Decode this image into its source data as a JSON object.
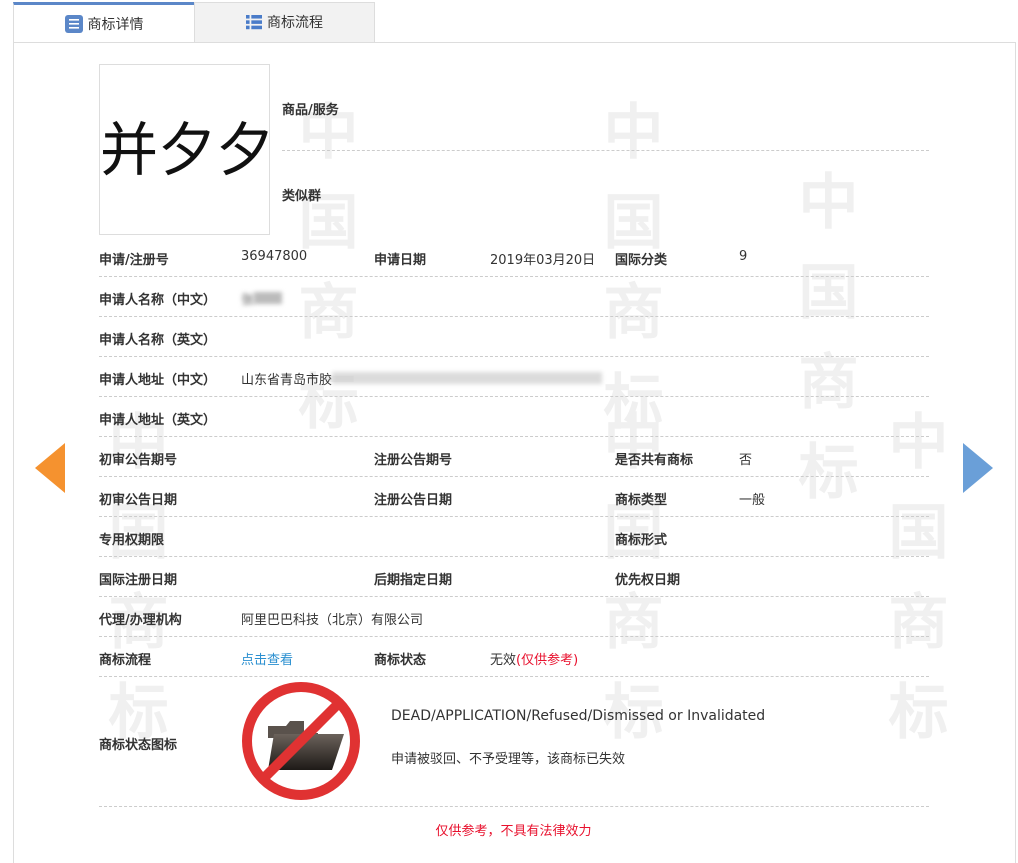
{
  "tabs": [
    {
      "label": "商标详情",
      "icon": "document-list-icon",
      "active": true
    },
    {
      "label": "商标流程",
      "icon": "grid-list-icon",
      "active": false
    }
  ],
  "logo_text": "并夕夕",
  "goods_label": "商品/服务",
  "similar_group_label": "类似群",
  "fields": {
    "reg_no": {
      "label": "申请/注册号",
      "value": "36947800"
    },
    "app_date": {
      "label": "申请日期",
      "value": "2019年03月20日"
    },
    "intl_class": {
      "label": "国际分类",
      "value": "9"
    },
    "applicant_cn": {
      "label": "申请人名称（中文）",
      "value": "张"
    },
    "applicant_en": {
      "label": "申请人名称（英文）",
      "value": ""
    },
    "address_cn": {
      "label": "申请人地址（中文）",
      "value": "山东省青岛市胶"
    },
    "address_en": {
      "label": "申请人地址（英文）",
      "value": ""
    },
    "prelim_issue": {
      "label": "初审公告期号",
      "value": ""
    },
    "reg_issue": {
      "label": "注册公告期号",
      "value": ""
    },
    "shared": {
      "label": "是否共有商标",
      "value": "否"
    },
    "prelim_date": {
      "label": "初审公告日期",
      "value": ""
    },
    "reg_date": {
      "label": "注册公告日期",
      "value": ""
    },
    "tm_type": {
      "label": "商标类型",
      "value": "一般"
    },
    "exclusive_term": {
      "label": "专用权期限",
      "value": ""
    },
    "tm_form": {
      "label": "商标形式",
      "value": ""
    },
    "intl_reg_date": {
      "label": "国际注册日期",
      "value": ""
    },
    "later_date": {
      "label": "后期指定日期",
      "value": ""
    },
    "priority_date": {
      "label": "优先权日期",
      "value": ""
    },
    "agency": {
      "label": "代理/办理机构",
      "value": "阿里巴巴科技（北京）有限公司"
    },
    "process": {
      "label": "商标流程",
      "link": "点击查看"
    },
    "status": {
      "label": "商标状态",
      "value": "无效",
      "note": "(仅供参考)"
    },
    "status_icon": {
      "label": "商标状态图标",
      "en": "DEAD/APPLICATION/Refused/Dismissed or Invalidated",
      "cn": "申请被驳回、不予受理等，该商标已失效"
    }
  },
  "disclaimer": "仅供参考，不具有法律效力",
  "watermark": "中国商标",
  "colors": {
    "accent": "#5b87c8",
    "prev_arrow": "#f5922f",
    "next_arrow": "#6a9fd8",
    "link": "#2a8fd0",
    "warning": "#e8102d"
  }
}
